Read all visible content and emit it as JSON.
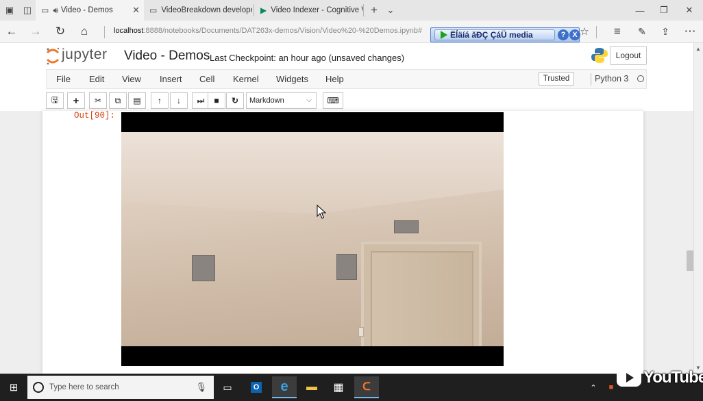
{
  "browser": {
    "tabs": [
      {
        "title": "Video - Demos",
        "active": true,
        "icon": "page-icon"
      },
      {
        "title": "VideoBreakdown developer",
        "active": false,
        "icon": "page-icon"
      },
      {
        "title": "Video Indexer - Cognitive V",
        "active": false,
        "icon": "video-indexer-icon"
      }
    ],
    "url_host": "localhost",
    "url_path": ":8888/notebooks/Documents/DAT263x-demos/Vision/Video%20-%20Demos.ipynb#",
    "overlay_label": "Ëĺäíá ăĐÇ ÇáÜ media",
    "overlay_help": "?",
    "overlay_close": "X"
  },
  "jupyter": {
    "logo_text": "jupyter",
    "notebook_title": "Video - Demos",
    "checkpoint": "Last Checkpoint: an hour ago (unsaved changes)",
    "logout_label": "Logout",
    "menu": [
      "File",
      "Edit",
      "View",
      "Insert",
      "Cell",
      "Kernel",
      "Widgets",
      "Help"
    ],
    "trusted_label": "Trusted",
    "kernel_name": "Python 3",
    "cell_type": "Markdown",
    "output_prompt": "Out[90]:"
  },
  "taskbar": {
    "search_placeholder": "Type here to search",
    "watermark": "YouTube"
  },
  "colors": {
    "jupyter_orange": "#f37726",
    "output_prompt": "#d84315",
    "taskbar": "#1f1f1f"
  }
}
